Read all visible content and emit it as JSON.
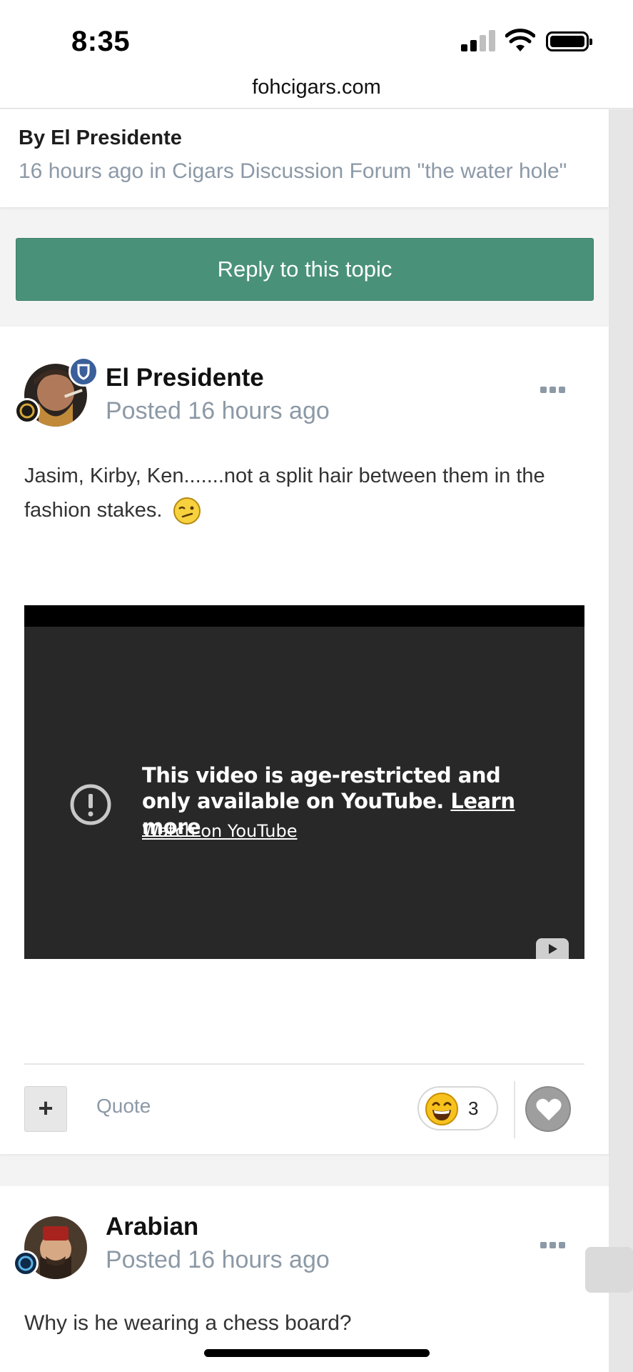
{
  "status_bar": {
    "time": "8:35"
  },
  "browser": {
    "domain": "fohcigars.com"
  },
  "topic": {
    "byline": "By El Presidente",
    "meta": "16 hours ago in Cigars Discussion Forum \"the water hole\""
  },
  "reply_button": "Reply to this topic",
  "post1": {
    "author": "El Presidente",
    "posted": "Posted 16 hours ago",
    "text": "Jasim, Kirby, Ken.......not a split hair between them in the fashion stakes.",
    "video": {
      "message": "This video is age-restricted and only available on YouTube.",
      "learn_more": "Learn more",
      "watch": "Watch on YouTube"
    },
    "actions": {
      "plus": "+",
      "quote": "Quote",
      "reaction_count": "3"
    }
  },
  "post2": {
    "author": "Arabian",
    "posted": "Posted 16 hours ago",
    "text": "Why is he wearing a chess board?"
  },
  "colors": {
    "reply_button_bg": "#4a917a",
    "meta_text": "#8c99a6",
    "mod_badge": "#3b5f9a"
  },
  "icons": [
    "signal-icon",
    "wifi-icon",
    "battery-icon",
    "moderator-shield-icon",
    "more-options-icon",
    "wink-emoji-icon",
    "exclamation-icon",
    "youtube-logo-icon",
    "plus-icon",
    "laughing-emoji-icon",
    "heart-icon"
  ]
}
